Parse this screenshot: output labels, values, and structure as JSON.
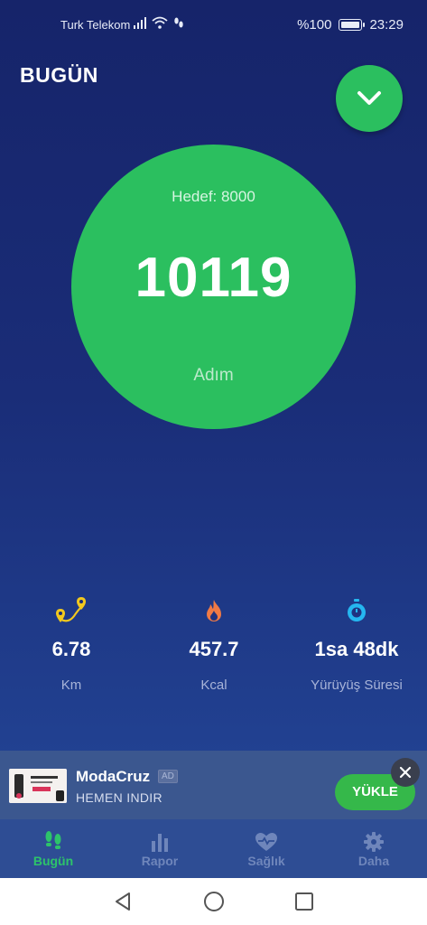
{
  "status": {
    "carrier": "Turk Telekom",
    "battery": "%100",
    "time": "23:29"
  },
  "header": {
    "title": "BUGÜN"
  },
  "ring": {
    "goal": "Hedef: 8000",
    "steps": "10119",
    "unit": "Adım"
  },
  "stats": [
    {
      "icon": "route-pin-icon",
      "value": "6.78",
      "label": "Km",
      "color": "#f2c81e"
    },
    {
      "icon": "flame-icon",
      "value": "457.7",
      "label": "Kcal",
      "color": "#f07a45"
    },
    {
      "icon": "stopwatch-icon",
      "value": "1sa 48dk",
      "label": "Yürüyüş Süresi",
      "color": "#25b7f0"
    }
  ],
  "ad": {
    "name": "ModaCruz",
    "badge": "AD",
    "subtitle": "HEMEN INDIR",
    "button": "YÜKLE"
  },
  "tabs": [
    {
      "label": "Bugün",
      "icon": "footsteps-icon",
      "active": true
    },
    {
      "label": "Rapor",
      "icon": "bar-chart-icon",
      "active": false
    },
    {
      "label": "Sağlık",
      "icon": "heart-pulse-icon",
      "active": false
    },
    {
      "label": "Daha",
      "icon": "gear-icon",
      "active": false
    }
  ],
  "colors": {
    "accent": "#2bbf5f",
    "background": "#1a2d78",
    "tab_inactive": "#6f86bb"
  }
}
